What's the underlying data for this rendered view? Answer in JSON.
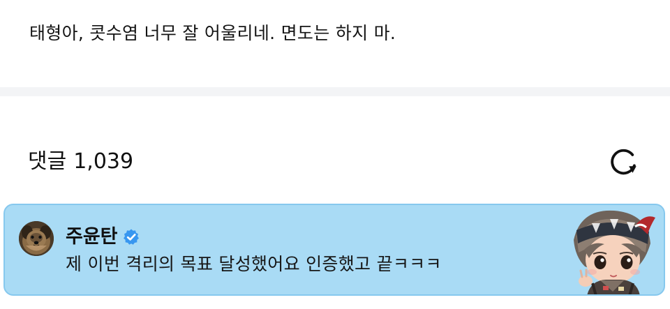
{
  "post": {
    "text": "태형아, 콧수염 너무 잘 어울리네. 면도는 하지 마."
  },
  "comments": {
    "label": "댓글",
    "count": "1,039",
    "refresh_icon": "refresh-icon"
  },
  "highlight_comment": {
    "author": "주윤탄",
    "verified_icon": "verified-badge-icon",
    "text": "제 이번 격리의 목표 달성했어요 인증했고 끝ㅋㅋㅋ",
    "background_color": "#a9dbf5",
    "border_color": "#86c8ee"
  },
  "colors": {
    "divider": "#f3f4f6",
    "verified_badge": "#3897f0"
  }
}
